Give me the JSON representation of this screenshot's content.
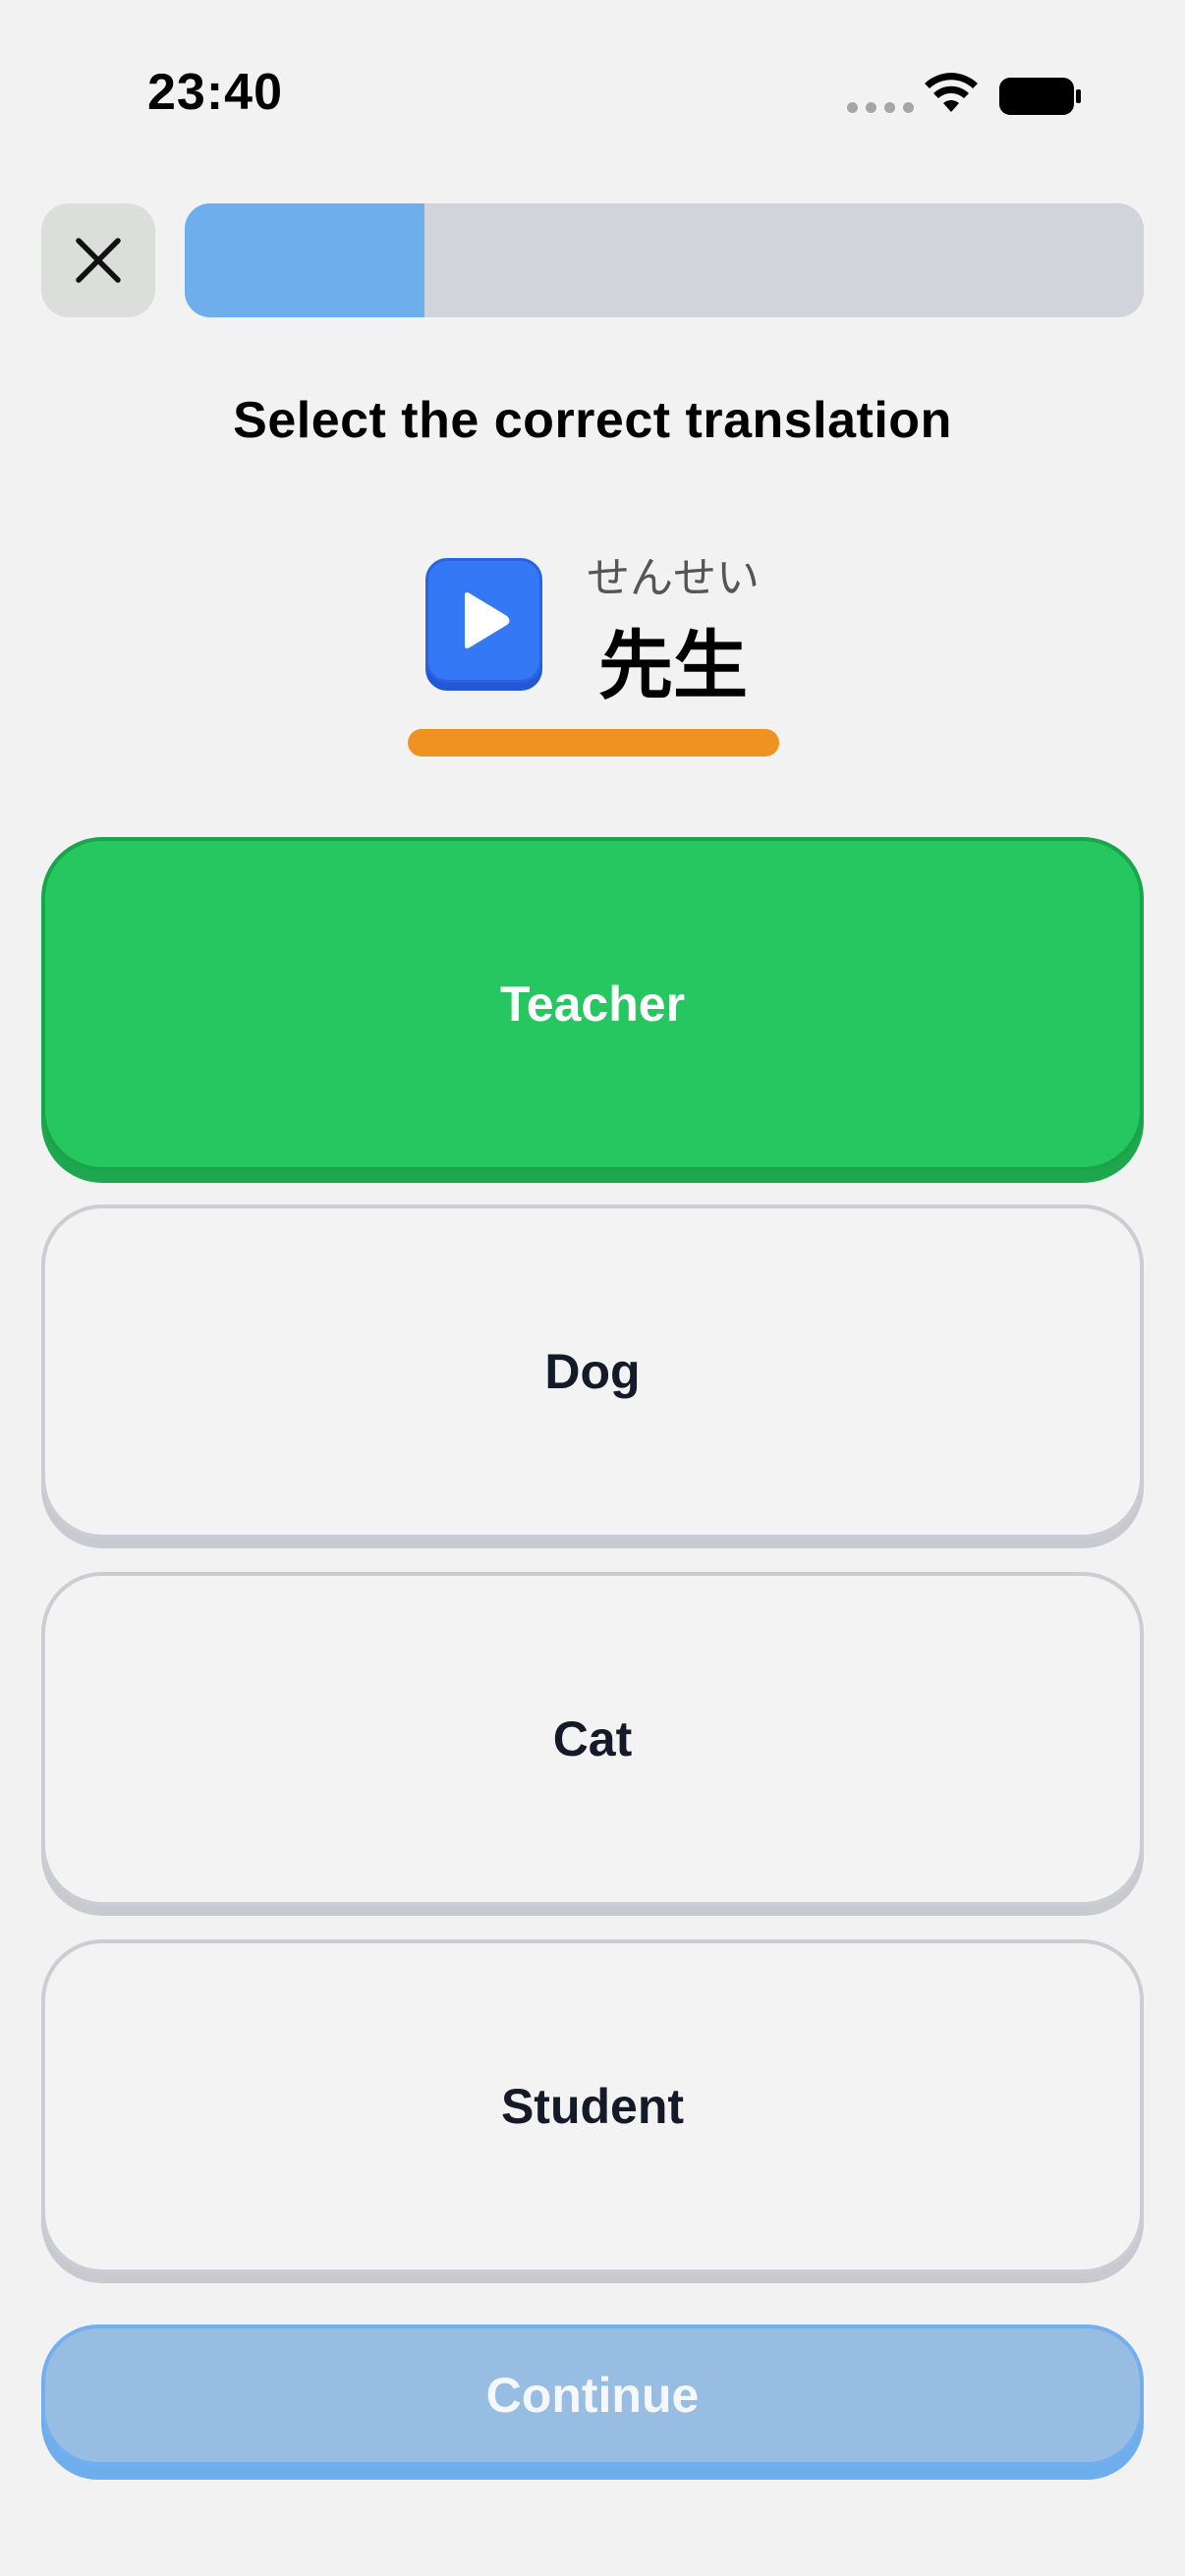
{
  "status_bar": {
    "time": "23:40"
  },
  "header": {
    "close_icon": "close-icon",
    "progress_fraction": 0.25
  },
  "lesson": {
    "instruction": "Select the correct translation",
    "audio_icon": "play-icon",
    "reading": "せんせい",
    "word": "先生"
  },
  "options": [
    {
      "label": "Teacher",
      "state": "selected"
    },
    {
      "label": "Dog",
      "state": "default"
    },
    {
      "label": "Cat",
      "state": "default"
    },
    {
      "label": "Student",
      "state": "default"
    }
  ],
  "footer": {
    "continue_label": "Continue"
  },
  "colors": {
    "background": "#f2f2f2",
    "progress_fill": "#6eaeec",
    "progress_track": "#d1d5db",
    "audio_button": "#3578f5",
    "underline": "#ef9221",
    "selected_option": "#26c661",
    "continue_button": "#97bde3"
  }
}
